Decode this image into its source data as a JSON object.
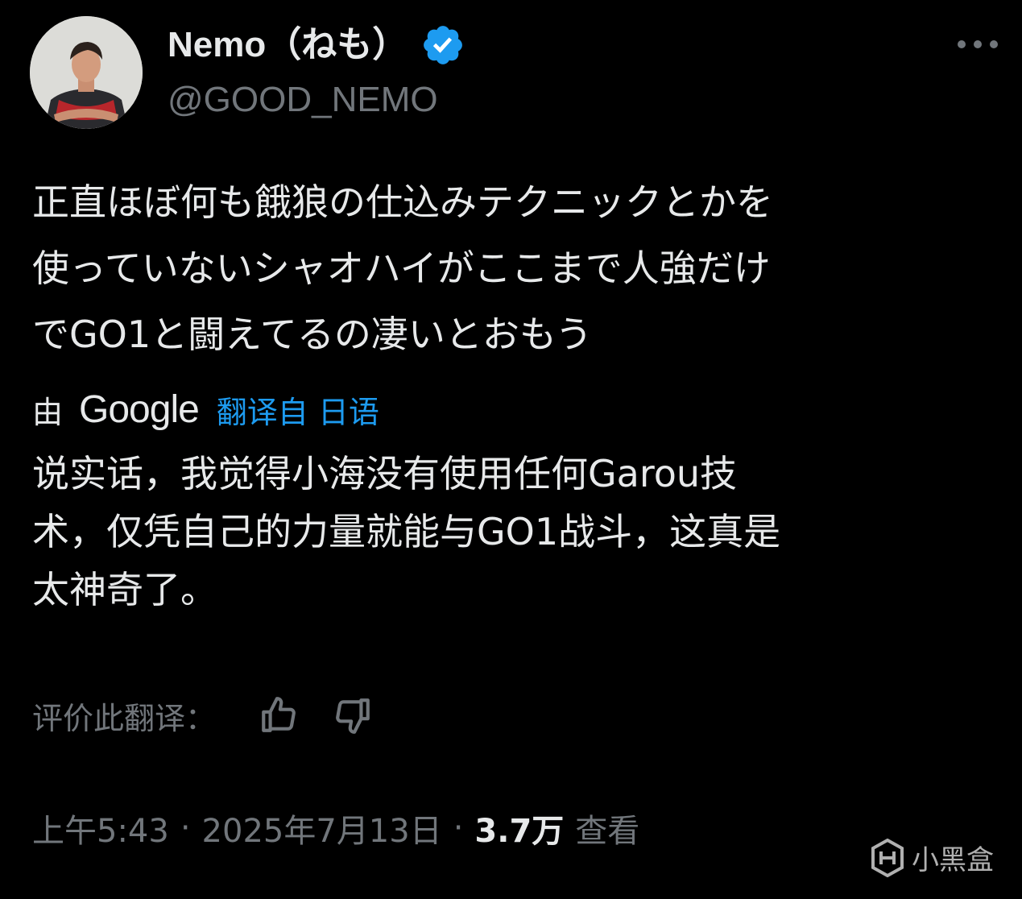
{
  "author": {
    "display_name": "Nemo（ねも）",
    "handle": "@GOOD_NEMO",
    "verified": true
  },
  "tweet": {
    "lines": [
      "正直ほぼ何も餓狼の仕込みテクニックとかを",
      "使っていないシャオハイがここまで人強だけ",
      "でGO1と闘えてるの凄いとおもう"
    ]
  },
  "translation": {
    "by_label": "由",
    "provider": "Google",
    "translated_from_label": "翻译自 日语",
    "lines": [
      "说实话，我觉得小海没有使用任何Garou技",
      "术，仅凭自己的力量就能与GO1战斗，这真是",
      "太神奇了。"
    ],
    "rate_label": "评价此翻译：",
    "thumbs_up_icon": "thumbs-up-icon",
    "thumbs_down_icon": "thumbs-down-icon"
  },
  "meta": {
    "time": "上午5:43",
    "separator": "·",
    "date": "2025年7月13日",
    "views_count": "3.7万",
    "views_label": "查看"
  },
  "watermark": {
    "text": "小黑盒"
  },
  "colors": {
    "background": "#000000",
    "text_primary": "#e7e9ea",
    "text_secondary": "#71767b",
    "accent_blue": "#1d9bf0"
  }
}
